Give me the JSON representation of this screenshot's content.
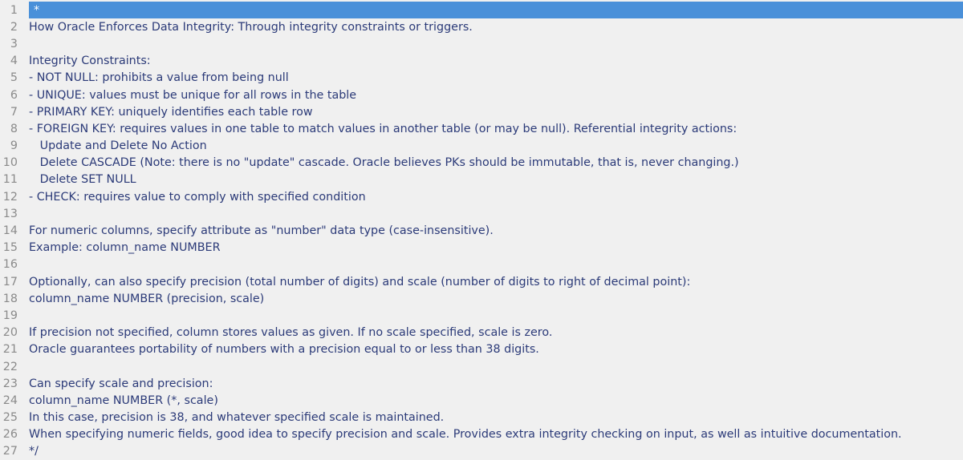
{
  "editor": {
    "lines": [
      "*",
      "How Oracle Enforces Data Integrity: Through integrity constraints or triggers.",
      "",
      "Integrity Constraints:",
      "- NOT NULL: prohibits a value from being null",
      "- UNIQUE: values must be unique for all rows in the table",
      "- PRIMARY KEY: uniquely identifies each table row",
      "- FOREIGN KEY: requires values in one table to match values in another table (or may be null). Referential integrity actions:",
      "   Update and Delete No Action",
      "   Delete CASCADE (Note: there is no \"update\" cascade. Oracle believes PKs should be immutable, that is, never changing.)",
      "   Delete SET NULL",
      "- CHECK: requires value to comply with specified condition",
      "",
      "For numeric columns, specify attribute as \"number\" data type (case-insensitive).",
      "Example: column_name NUMBER",
      "",
      "Optionally, can also specify precision (total number of digits) and scale (number of digits to right of decimal point):",
      "column_name NUMBER (precision, scale)",
      "",
      "If precision not specified, column stores values as given. If no scale specified, scale is zero.",
      "Oracle guarantees portability of numbers with a precision equal to or less than 38 digits.",
      "",
      "Can specify scale and precision:",
      "column_name NUMBER (*, scale)",
      "In this case, precision is 38, and whatever specified scale is maintained.",
      "When specifying numeric fields, good idea to specify precision and scale. Provides extra integrity checking on input, as well as intuitive documentation.",
      "*/"
    ],
    "line_numbers": [
      "1",
      "2",
      "3",
      "4",
      "5",
      "6",
      "7",
      "8",
      "9",
      "10",
      "11",
      "12",
      "13",
      "14",
      "15",
      "16",
      "17",
      "18",
      "19",
      "20",
      "21",
      "22",
      "23",
      "24",
      "25",
      "26",
      "27"
    ],
    "active_line_color": "#4a90d9",
    "text_color": "#2b3a78",
    "gutter_color": "#8a8a8a",
    "background_color": "#f0f0f0"
  }
}
